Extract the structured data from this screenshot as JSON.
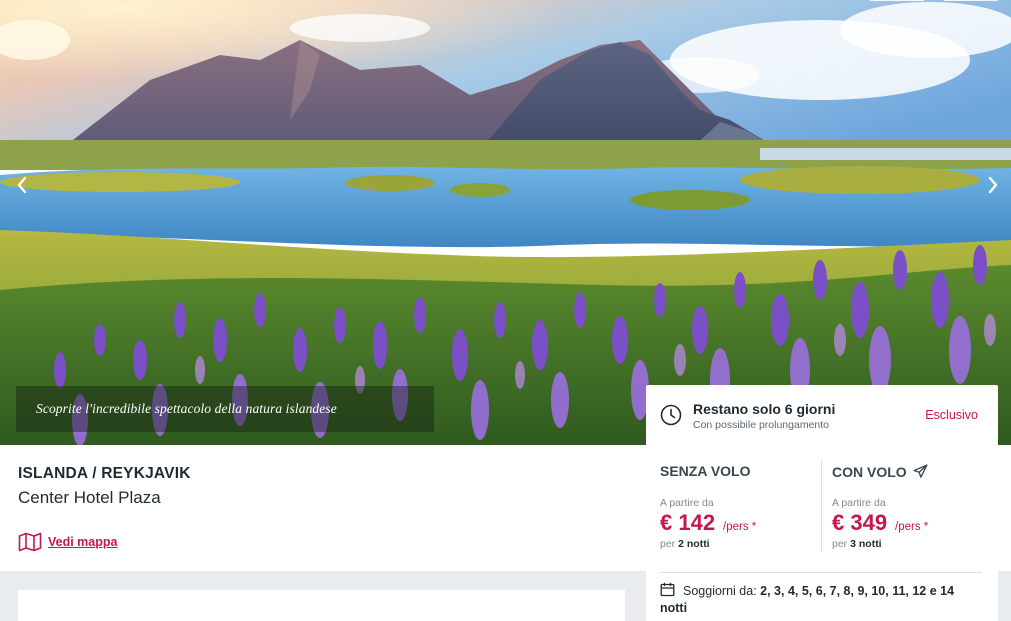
{
  "hero": {
    "caption": "Scoprite l'incredibile spettacolo della natura islandese",
    "prev_icon": "chevron-left-icon",
    "next_icon": "chevron-right-icon"
  },
  "deadline": {
    "title": "Restano solo 6 giorni",
    "subtitle": "Con possibile prolungamento",
    "badge": "Esclusivo",
    "icon": "clock-icon"
  },
  "location": "ISLANDA / REYKJAVIK",
  "hotel_name": "Center Hotel Plaza",
  "map_link": "Vedi mappa",
  "offers": {
    "without_flight": {
      "label": "SENZA VOLO",
      "from": "A partire da",
      "price": "€ 142",
      "unit": "/pers *",
      "per": "per",
      "nights": "2 notti"
    },
    "with_flight": {
      "label": "CON VOLO",
      "icon": "airplane-icon",
      "from": "A partire da",
      "price": "€ 349",
      "unit": "/pers *",
      "per": "per",
      "nights": "3 notti"
    }
  },
  "stays": {
    "label": "Soggiorni da:",
    "values": "2, 3, 4, 5, 6, 7, 8, 9, 10, 11, 12 e 14 notti"
  },
  "colors": {
    "accent": "#c6164f",
    "text": "#1f2a33",
    "muted": "#7d8a95",
    "panel_bg": "#e9ecee"
  }
}
